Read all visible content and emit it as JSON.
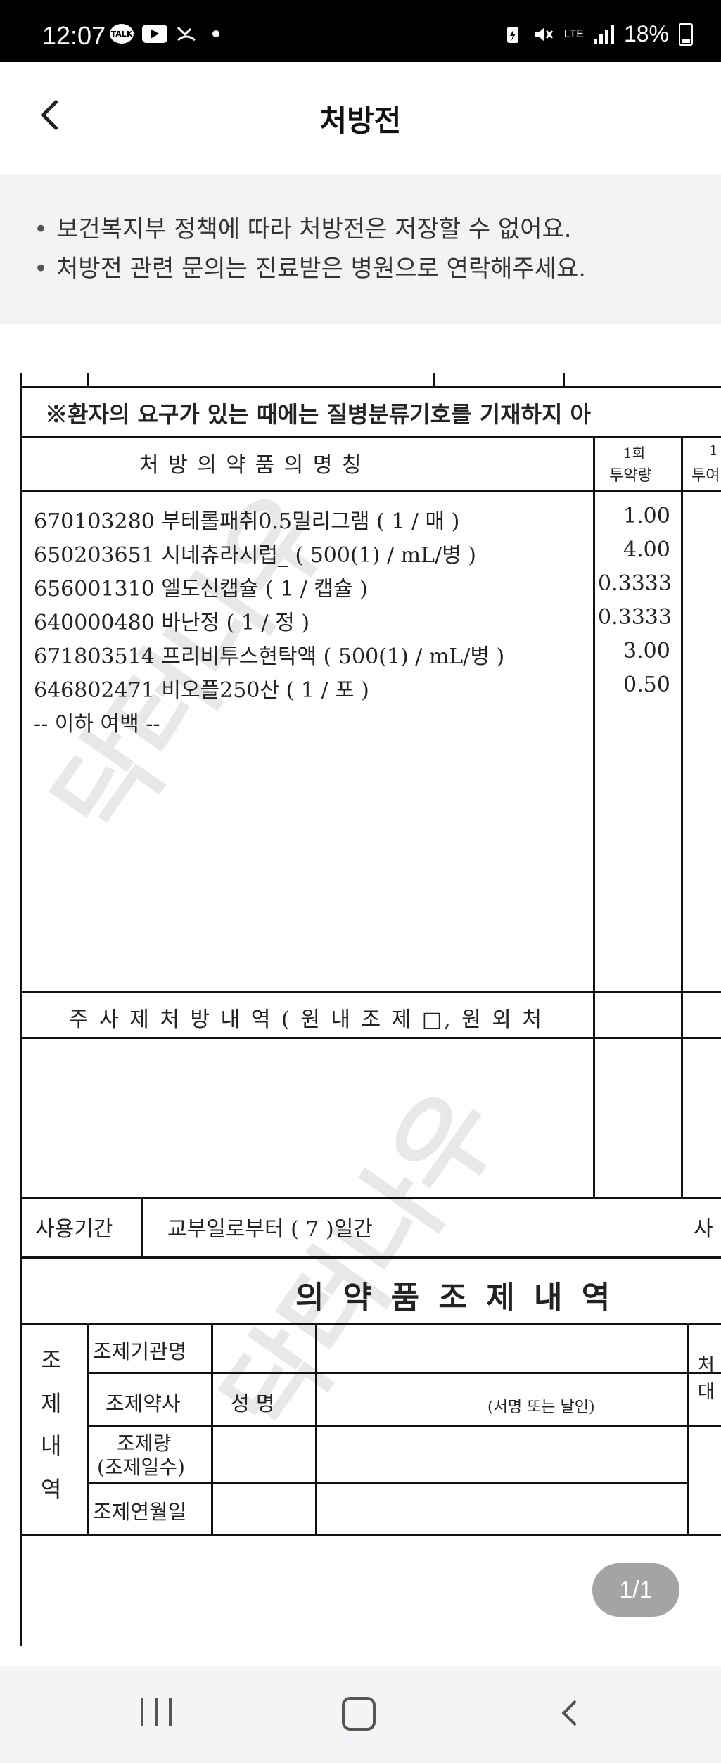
{
  "status_bar": {
    "time": "12:07",
    "talk_icon_text": "TALK",
    "network": "LTE",
    "battery": "18%"
  },
  "header": {
    "title": "처방전"
  },
  "notice": {
    "items": [
      "보건복지부 정책에 따라 처방전은 저장할 수 없어요.",
      "처방전 관련 문의는 진료받은 병원으로 연락해주세요."
    ]
  },
  "document": {
    "notice_line": "※환자의 요구가 있는 때에는 질병분류기호를 기재하지 아",
    "col_drug_name": "처 방 의 약 품 의   명 칭",
    "col_dose_line1": "1회",
    "col_dose_line2": "투약량",
    "col_next_line1": "1",
    "col_next_line2": "투여",
    "drugs": [
      {
        "code": "670103280",
        "name": "부테롤패취0.5밀리그램 ( 1 / 매 )",
        "dose": "1.00"
      },
      {
        "code": "650203651",
        "name": "시네츄라시럽_ ( 500(1) / mL/병 )",
        "dose": "4.00"
      },
      {
        "code": "656001310",
        "name": "엘도신캡슐 ( 1 / 캡슐 )",
        "dose": "0.3333"
      },
      {
        "code": "640000480",
        "name": "바난정 ( 1 / 정 )",
        "dose": "0.3333"
      },
      {
        "code": "671803514",
        "name": "프리비투스현탁액 ( 500(1) / mL/병 )",
        "dose": "3.00"
      },
      {
        "code": "646802471",
        "name": "비오플250산 ( 1 / 포 )",
        "dose": "0.50"
      }
    ],
    "end_marker": "-- 이하 여백 --",
    "injection_header": "주 사 제    처 방 내 역  ( 원 내 조 제 □,  원 외 처",
    "usage_label": "사용기간",
    "usage_value": "교부일로부터 (    7    )일간",
    "usage_right": "사",
    "dispensing_title": "의  약  품  조  제  내  역",
    "dispensing_side": [
      "조",
      "제",
      "내",
      "역"
    ],
    "dispensing_rows": [
      "조제기관명",
      "조제약사",
      "조제량",
      "(조제일수)",
      "조제연월일"
    ],
    "pharmacist_name_label": "성  명",
    "signature_hint": "(서명 또는 날인)",
    "right_fragment_1": "처",
    "right_fragment_2": "대",
    "watermark_text": "닥터나우"
  },
  "viewer": {
    "page_indicator": "1/1"
  }
}
